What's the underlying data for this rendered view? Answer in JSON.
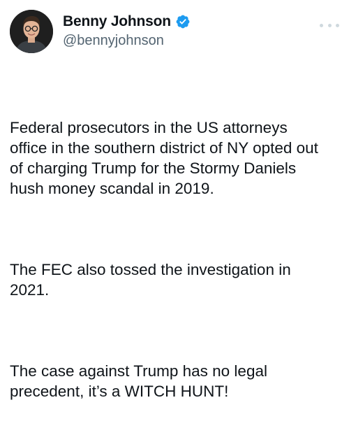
{
  "author": {
    "display_name": "Benny Johnson",
    "handle": "@bennyjohnson",
    "verified": true,
    "verified_icon": "verified-badge-icon",
    "verified_color": "#1d9bf0"
  },
  "menu": {
    "icon": "more-options-icon"
  },
  "tweet": {
    "paragraphs": [
      "Federal prosecutors in the US attorneys\noffice in the southern district of NY opted out\nof charging Trump for the Stormy Daniels\nhush money scandal in 2019.",
      "The FEC also tossed the investigation in\n2021.",
      "The case against Trump has no legal\nprecedent, it’s a WITCH HUNT!"
    ]
  },
  "colors": {
    "text": "#0f1419",
    "secondary_text": "#536471",
    "background": "#ffffff"
  }
}
